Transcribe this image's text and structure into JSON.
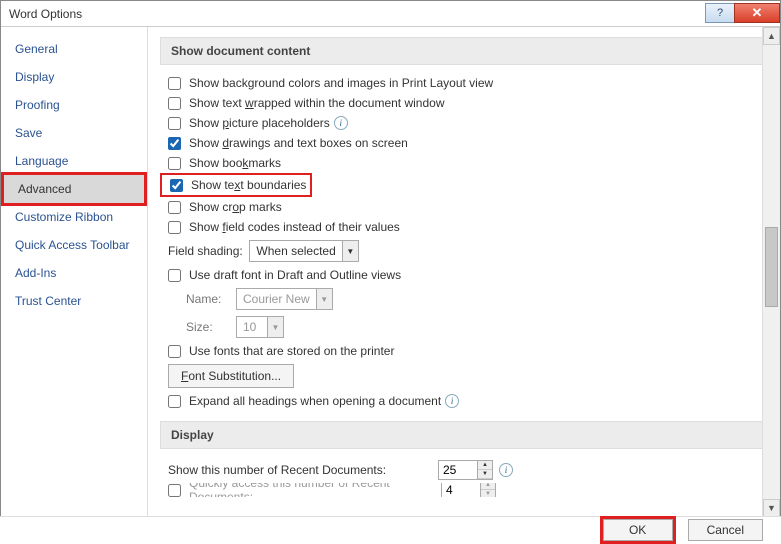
{
  "title": "Word Options",
  "sidebar": [
    "General",
    "Display",
    "Proofing",
    "Save",
    "Language",
    "Advanced",
    "Customize Ribbon",
    "Quick Access Toolbar",
    "Add-Ins",
    "Trust Center"
  ],
  "section1": "Show document content",
  "opts": {
    "bg": "Show background colors and images in Print Layout view",
    "wrap_pre": "Show text ",
    "wrap_u": "w",
    "wrap_post": "rapped within the document window",
    "pict_pre": "Show ",
    "pict_u": "p",
    "pict_post": "icture placeholders",
    "draw_pre": "Show ",
    "draw_u": "d",
    "draw_post": "rawings and text boxes on screen",
    "book_pre": "Show boo",
    "book_u": "k",
    "book_post": "marks",
    "txtb_pre": "Show te",
    "txtb_u": "x",
    "txtb_post": "t boundaries",
    "crop_pre": "Show cr",
    "crop_u": "o",
    "crop_post": "p marks",
    "field_pre": "Show ",
    "field_u": "f",
    "field_post": "ield codes instead of their values",
    "shading_lbl": "Field shading:",
    "shading_val": "When selected",
    "draft": "Use draft font in Draft and Outline views",
    "name_lbl": "Name:",
    "name_val": "Courier New",
    "size_lbl": "Size:",
    "size_val": "10",
    "printer": "Use fonts that are stored on the printer",
    "fontsub_pre": "",
    "fontsub_u": "F",
    "fontsub_post": "ont Substitution...",
    "expand": "Expand all headings when opening a document"
  },
  "section2": "Display",
  "recent_lbl": "Show this number of Recent Documents:",
  "recent_val": "25",
  "quick_lbl": "Quickly access this number of Recent Documents:",
  "quick_val": "4",
  "ok": "OK",
  "cancel": "Cancel"
}
